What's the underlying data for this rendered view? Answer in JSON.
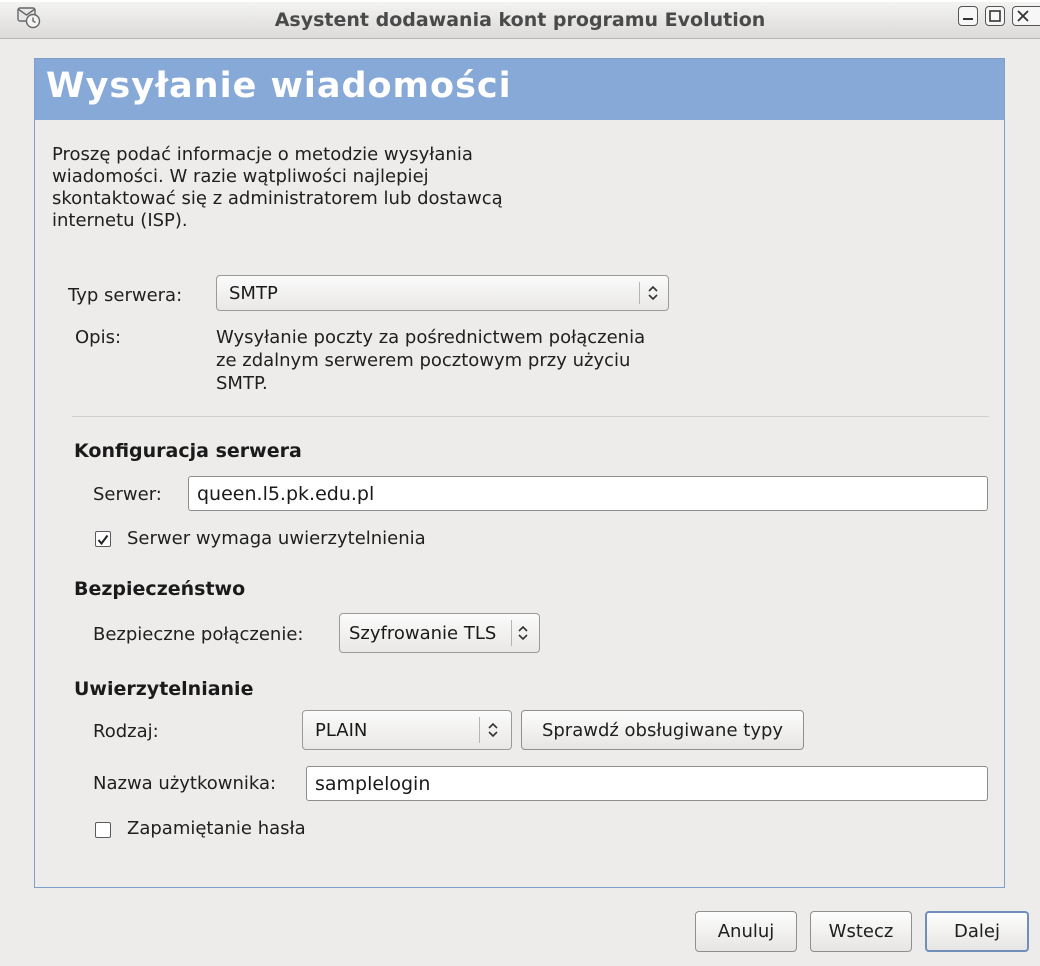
{
  "window": {
    "title": "Asystent dodawania kont programu Evolution",
    "icon": "evolution-icon",
    "controls": [
      "minimize-icon",
      "maximize-icon",
      "close-icon"
    ]
  },
  "page": {
    "heading": "Wysyłanie wiadomości",
    "intro_lines": [
      "Proszę podać informacje o metodzie wysyłania",
      "wiadomości. W razie wątpliwości najlepiej",
      "skontaktować się z  administratorem lub dostawcą",
      "internetu (ISP)."
    ]
  },
  "server_type": {
    "label": "Typ serwera:",
    "value": "SMTP",
    "description_label": "Opis:",
    "description_lines": [
      "Wysyłanie poczty za pośrednictwem połączenia",
      "ze zdalnym serwerem pocztowym przy użyciu",
      "SMTP."
    ]
  },
  "server_config": {
    "section_title": "Konfiguracja serwera",
    "server_label": "Serwer:",
    "server_value": "queen.l5.pk.edu.pl",
    "auth_required_label": "Serwer wymaga uwierzytelnienia",
    "auth_required_checked": true
  },
  "security": {
    "section_title": "Bezpieczeństwo",
    "secure_conn_label": "Bezpieczne połączenie:",
    "secure_conn_value": "Szyfrowanie TLS"
  },
  "authentication": {
    "section_title": "Uwierzytelnianie",
    "type_label": "Rodzaj:",
    "type_value": "PLAIN",
    "check_types_button": "Sprawdź obsługiwane typy",
    "username_label": "Nazwa użytkownika:",
    "username_value": "samplelogin",
    "remember_password_label": "Zapamiętanie hasła",
    "remember_password_checked": false
  },
  "footer": {
    "cancel": "Anuluj",
    "back": "Wstecz",
    "next": "Dalej"
  },
  "colors": {
    "banner": "#87a9d7",
    "banner_text": "#ffffff",
    "window_bg": "#edeceb"
  }
}
